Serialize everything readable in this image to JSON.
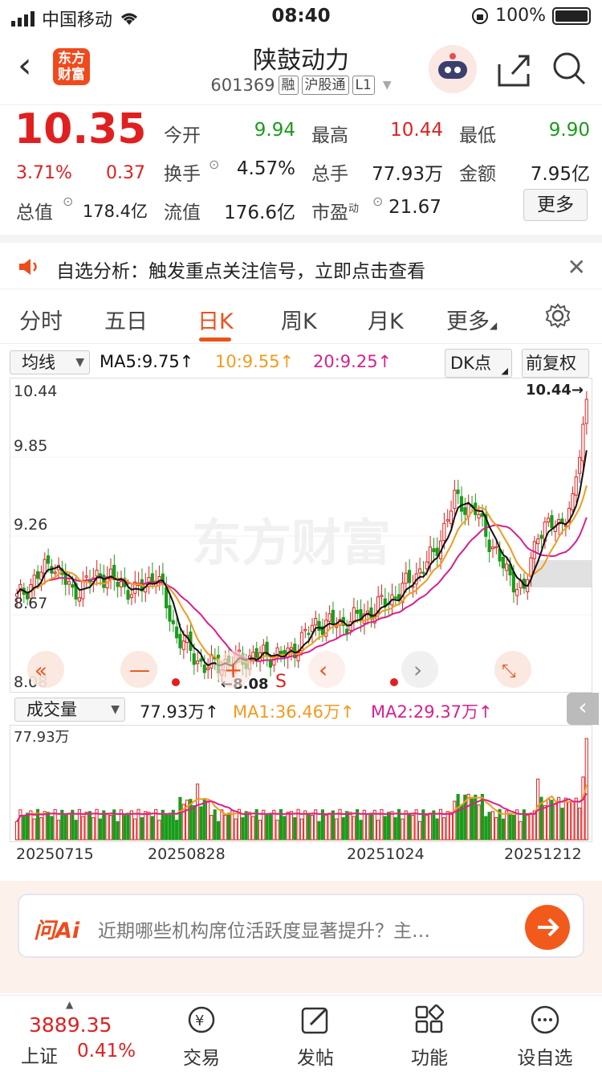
{
  "status_bar": {
    "carrier": "中国移动",
    "time": "08:40",
    "battery": "100%"
  },
  "header": {
    "logo_top": "东方",
    "logo_bottom": "财富",
    "title": "陕鼓动力",
    "code": "601369",
    "tags": [
      "融",
      "沪股通",
      "L1"
    ]
  },
  "quote": {
    "price": "10.35",
    "change_pct": "3.71%",
    "change": "0.37",
    "open_label": "今开",
    "open": "9.94",
    "high_label": "最高",
    "high": "10.44",
    "low_label": "最低",
    "low": "9.90",
    "turnover_label": "换手",
    "turnover": "4.57%",
    "volume_label": "总手",
    "volume": "77.93万",
    "amount_label": "金额",
    "amount": "7.95亿",
    "mktcap_label": "总值",
    "mktcap": "178.4亿",
    "float_label": "流值",
    "float": "176.6亿",
    "pe_label": "市盈",
    "pe_sup": "动",
    "pe": "21.67",
    "more": "更多"
  },
  "alert": {
    "text": "自选分析：触发重点关注信号，立即点击查看"
  },
  "tabs": [
    "分时",
    "五日",
    "日K",
    "周K",
    "月K",
    "更多"
  ],
  "active_tab": "日K",
  "ma_bar": {
    "selector": "均线",
    "ma5": "MA5:9.75↑",
    "ma10": "10:9.55↑",
    "ma20": "20:9.25↑",
    "dk": "DK点",
    "adjust": "前复权"
  },
  "price_axis": [
    "10.44",
    "9.85",
    "9.26",
    "8.67",
    "8.08"
  ],
  "chart_labels": {
    "max": "10.44→",
    "min": "←8.08",
    "sell_mark": "S",
    "watermark": "东方财富"
  },
  "volume_bar": {
    "selector": "成交量",
    "vol": "77.93万↑",
    "ma1": "MA1:36.46万↑",
    "ma2": "MA2:29.37万↑",
    "axis_max": "77.93万"
  },
  "dates": [
    "20250715",
    "20250828",
    "20251024",
    "20251212"
  ],
  "ai": {
    "logo": "问Ai",
    "question": "近期哪些机构席位活跃度显著提升？主…"
  },
  "bottom": {
    "index_value": "3889.35",
    "index_name": "上证",
    "index_pct": "0.41%",
    "items": [
      "交易",
      "发帖",
      "功能",
      "设自选"
    ]
  },
  "colors": {
    "up": "#e02020",
    "down": "#1a9c1a",
    "accent": "#e8541e",
    "ma5": "#111111",
    "ma10": "#f39a1e",
    "ma20": "#d6218f"
  },
  "chart_data": {
    "type": "candlestick",
    "ylim": [
      8.08,
      10.44
    ],
    "x_ticks": [
      "20250715",
      "20250828",
      "20251024",
      "20251212"
    ],
    "last_close": 10.35,
    "last_volume": "77.93万",
    "series": [
      {
        "name": "MA5",
        "last": 9.75
      },
      {
        "name": "MA10",
        "last": 9.55
      },
      {
        "name": "MA20",
        "last": 9.25
      }
    ]
  }
}
